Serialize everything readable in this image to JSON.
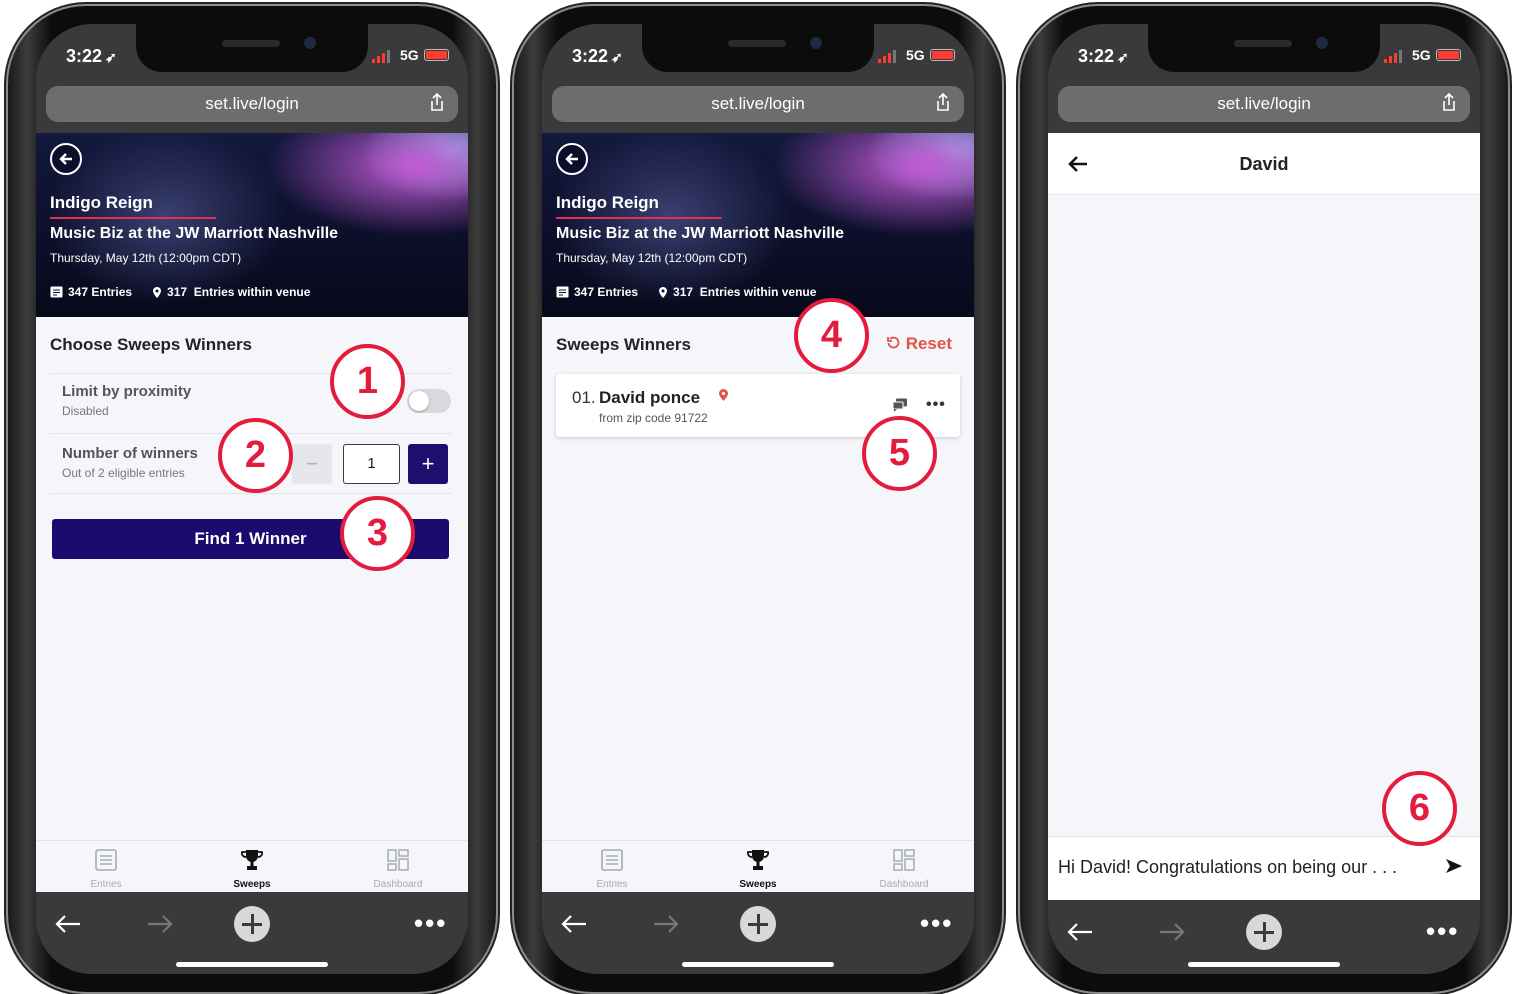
{
  "status": {
    "time": "3:22",
    "network": "5G"
  },
  "browser": {
    "url": "set.live/login"
  },
  "event": {
    "artist": "Indigo Reign",
    "title": "Music Biz at the JW Marriott Nashville",
    "date": "Thursday, May 12th (12:00pm CDT)",
    "entries": "347 Entries",
    "venue_count": "317",
    "venue_label": "Entries within venue"
  },
  "tabs": {
    "entries": "Entries",
    "sweeps": "Sweeps",
    "dashboard": "Dashboard"
  },
  "choose": {
    "title": "Choose Sweeps Winners",
    "proximity_label": "Limit by proximity",
    "proximity_state": "Disabled",
    "winners_label": "Number of winners",
    "winners_sub": "Out of 2 eligible entries",
    "minus": "−",
    "count": "1",
    "plus": "+",
    "find_button": "Find 1 Winner"
  },
  "results": {
    "title": "Sweeps Winners",
    "reset": "Reset",
    "winner_num": "01.",
    "winner_name": "David ponce",
    "winner_zip": "from zip code 91722",
    "more": "•••"
  },
  "chat": {
    "title": "David",
    "message": "Hi David! Congratulations on being our . . ."
  },
  "callouts": [
    "1",
    "2",
    "3",
    "4",
    "5",
    "6"
  ],
  "colors": {
    "primary": "#1d0a6e",
    "accent": "#e2534a",
    "callout": "#e31b3c"
  }
}
